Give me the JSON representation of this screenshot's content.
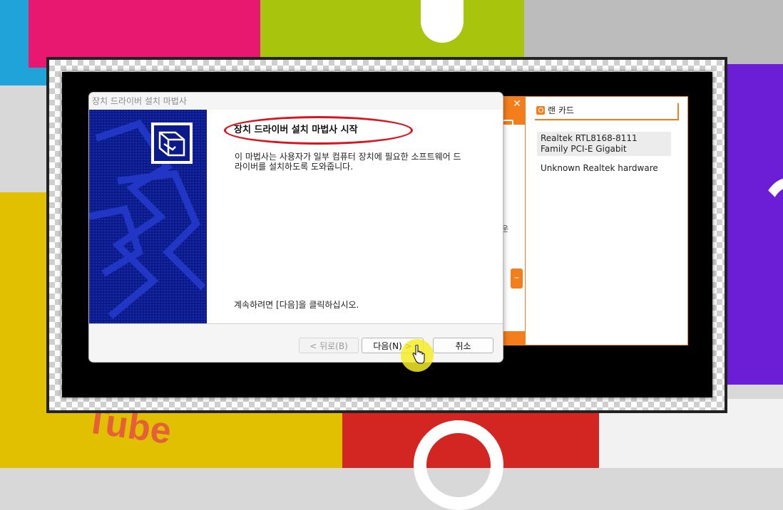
{
  "dialog": {
    "title": "장치 드라이버 설치 마법사",
    "heading": "장치 드라이버 설치 마법사 시작",
    "description": "이 마법사는 사용자가 일부 컴퓨터 장치에 필요한 소프트웨어 드라이버를 설치하도록 도와줍니다.",
    "continue_text": "계속하려면 [다음]을 클릭하십시오.",
    "buttons": {
      "back": "< 뒤로(B)",
      "next": "다음(N) >",
      "cancel": "취소"
    }
  },
  "right_panel": {
    "search_label": "랜 카드",
    "items": [
      {
        "label": "Realtek RTL8168-8111 Family PCI-E Gigabit"
      },
      {
        "label": "Unknown Realtek hardware"
      }
    ]
  },
  "behind_window": {
    "close_glyph": "✕",
    "partial_text_1": "운",
    "partial_text_2": ".",
    "stub_glyph": "–"
  },
  "background": {
    "tube_text": "Tube"
  },
  "colors": {
    "accent_orange": "#f37e1b",
    "highlight_red": "#d9141e",
    "wizard_blue": "#0a1a8a"
  }
}
